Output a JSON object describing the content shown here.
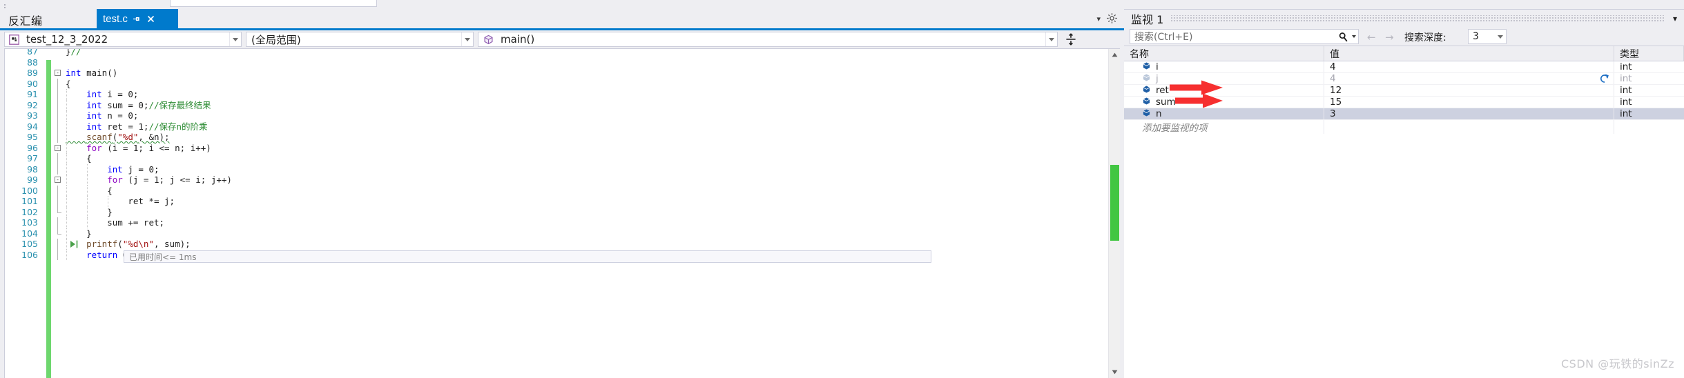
{
  "colors": {
    "accent_blue": "#007acc",
    "changebar_green": "#6ed76e",
    "scroll_thumb_green": "#42c642",
    "annotation_red": "#f62f2f",
    "keyword_blue": "#0000ff",
    "control_purple": "#8f08c4",
    "comment_green": "#2c8c33",
    "string_red": "#a31515",
    "linenumber_blue": "#2b91af",
    "selected_row": "#cdd1e0",
    "panel_gray": "#eeeef2"
  },
  "tabstrip": {
    "disassembly_label": "反汇编",
    "active_tab": {
      "name": "test.c",
      "pin_icon": "pin-icon",
      "close_icon": "close-icon"
    },
    "overflow_chevron_icon": "chevron-down-icon",
    "gear_icon": "gear-icon"
  },
  "navbar": {
    "project": {
      "icon": "project-icon",
      "value": "test_12_3_2022",
      "arrow_icon": "chevron-down-icon"
    },
    "scope": {
      "value": "(全局范围)",
      "arrow_icon": "chevron-down-icon"
    },
    "function": {
      "icon": "cube-icon",
      "value": "main()",
      "arrow_icon": "chevron-down-icon"
    },
    "split_view_icon": "split-view-icon"
  },
  "editor": {
    "code_lines": [
      {
        "n": "87",
        "fold": "",
        "indent_guides": [],
        "html": "<span class=\"t-punct\"></span>",
        "partial_top": true,
        "text": "}//"
      },
      {
        "n": "88",
        "fold": "",
        "text": ""
      },
      {
        "n": "89",
        "fold": "minus",
        "text": "int main()"
      },
      {
        "n": "90",
        "fold": "vline",
        "text": "{"
      },
      {
        "n": "91",
        "fold": "vline",
        "text": "    int i = 0;"
      },
      {
        "n": "92",
        "fold": "vline",
        "text": "    int sum = 0;//保存最终结果"
      },
      {
        "n": "93",
        "fold": "vline",
        "text": "    int n = 0;"
      },
      {
        "n": "94",
        "fold": "vline",
        "text": "    int ret = 1;//保存n的阶乘"
      },
      {
        "n": "95",
        "fold": "vline",
        "text": "    scanf(\"%d\", &n);"
      },
      {
        "n": "96",
        "fold": "minus",
        "text": "    for (i = 1; i <= n; i++)"
      },
      {
        "n": "97",
        "fold": "vline",
        "text": "    {"
      },
      {
        "n": "98",
        "fold": "vline",
        "text": "        int j = 0;"
      },
      {
        "n": "99",
        "fold": "minus",
        "text": "        for (j = 1; j <= i; j++)"
      },
      {
        "n": "100",
        "fold": "vline",
        "text": "        {"
      },
      {
        "n": "101",
        "fold": "vline",
        "text": "            ret *= j;"
      },
      {
        "n": "102",
        "fold": "end",
        "text": "        }"
      },
      {
        "n": "103",
        "fold": "vline",
        "text": "        sum += ret;"
      },
      {
        "n": "104",
        "fold": "end",
        "text": "    }"
      },
      {
        "n": "105",
        "fold": "vline",
        "text": "    printf(\"%d\\n\", sum);",
        "exec_marker": true
      },
      {
        "n": "106",
        "fold": "vline",
        "text": "    return 0;",
        "partial_bottom": true
      }
    ],
    "datatip_text": "已用时间<= 1ms",
    "scrollbar": {
      "up_arrow_icon": "scroll-up-icon",
      "down_arrow_icon": "scroll-down-icon",
      "thumb": "scroll-thumb"
    }
  },
  "watch_panel": {
    "title": "监视 1",
    "collapse_chevron_icon": "chevron-down-icon",
    "search": {
      "placeholder": "搜索(Ctrl+E)",
      "value": "",
      "search_icon": "search-icon",
      "options_caret_icon": "caret-down-icon"
    },
    "nav_prev_icon": "arrow-left-icon",
    "nav_next_icon": "arrow-right-icon",
    "depth_label": "搜索深度:",
    "depth_value": "3",
    "columns": [
      "名称",
      "值",
      "类型"
    ],
    "rows": [
      {
        "name": "i",
        "value": "4",
        "type": "int",
        "stale": false,
        "selected": false,
        "icon": "variable-icon"
      },
      {
        "name": "j",
        "value": "4",
        "type": "int",
        "stale": true,
        "selected": false,
        "icon": "variable-icon",
        "refresh_icon": "refresh-icon"
      },
      {
        "name": "ret",
        "value": "12",
        "type": "int",
        "stale": false,
        "selected": false,
        "icon": "variable-icon"
      },
      {
        "name": "sum",
        "value": "15",
        "type": "int",
        "stale": false,
        "selected": false,
        "icon": "variable-icon"
      },
      {
        "name": "n",
        "value": "3",
        "type": "int",
        "stale": false,
        "selected": true,
        "icon": "variable-icon"
      }
    ],
    "add_item_placeholder": "添加要监视的项"
  },
  "annotations": {
    "arrow_targets": [
      "ret",
      "sum"
    ],
    "color": "#f62f2f"
  },
  "watermark": "CSDN @玩铁的sinZz"
}
